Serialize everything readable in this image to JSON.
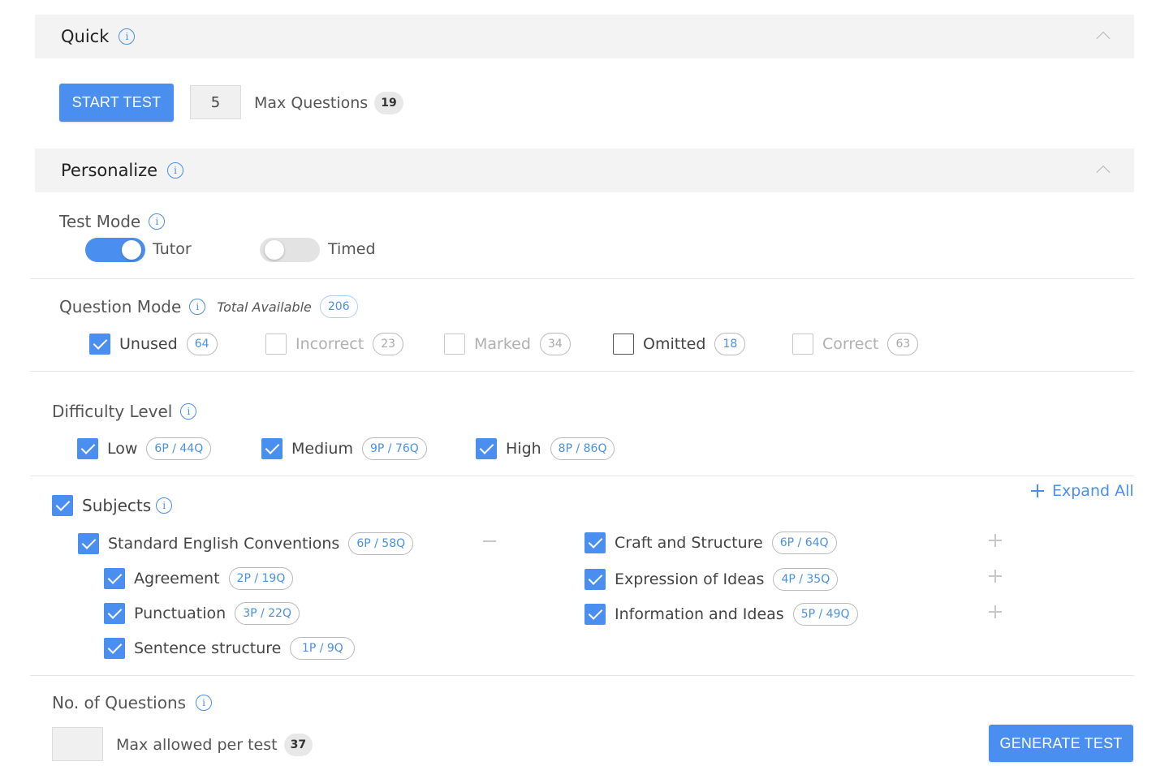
{
  "quick": {
    "title": "Quick",
    "start_label": "START TEST",
    "question_count": "5",
    "max_label": "Max Questions",
    "max_value": "19"
  },
  "personalize": {
    "title": "Personalize"
  },
  "test_mode": {
    "title": "Test Mode",
    "tutor_label": "Tutor",
    "tutor_on": true,
    "timed_label": "Timed",
    "timed_on": false
  },
  "question_mode": {
    "title": "Question Mode",
    "total_label": "Total Available",
    "total_value": "206",
    "options": [
      {
        "label": "Unused",
        "count": "64",
        "checked": true
      },
      {
        "label": "Incorrect",
        "count": "23",
        "checked": false
      },
      {
        "label": "Marked",
        "count": "34",
        "checked": false
      },
      {
        "label": "Omitted",
        "count": "18",
        "checked": false
      },
      {
        "label": "Correct",
        "count": "63",
        "checked": false
      }
    ]
  },
  "difficulty": {
    "title": "Difficulty Level",
    "levels": [
      {
        "label": "Low",
        "count": "6P / 44Q",
        "checked": true
      },
      {
        "label": "Medium",
        "count": "9P / 76Q",
        "checked": true
      },
      {
        "label": "High",
        "count": "8P / 86Q",
        "checked": true
      }
    ]
  },
  "subjects": {
    "title": "Subjects",
    "expand_all": "Expand All",
    "left_group": {
      "label": "Standard English Conventions",
      "count": "6P / 58Q",
      "children": [
        {
          "label": "Agreement",
          "count": "2P / 19Q"
        },
        {
          "label": "Punctuation",
          "count": "3P / 22Q"
        },
        {
          "label": "Sentence structure",
          "count": "1P / 9Q"
        }
      ]
    },
    "right_groups": [
      {
        "label": "Craft and Structure",
        "count": "6P / 64Q"
      },
      {
        "label": "Expression of Ideas",
        "count": "4P / 35Q"
      },
      {
        "label": "Information and Ideas",
        "count": "5P / 49Q"
      }
    ]
  },
  "num_questions": {
    "title": "No. of Questions",
    "value": "",
    "max_label": "Max allowed per test",
    "max_value": "37",
    "generate_label": "GENERATE TEST"
  },
  "colors": {
    "accent": "#4a8ff0",
    "header_bg": "#f3f3f3"
  }
}
